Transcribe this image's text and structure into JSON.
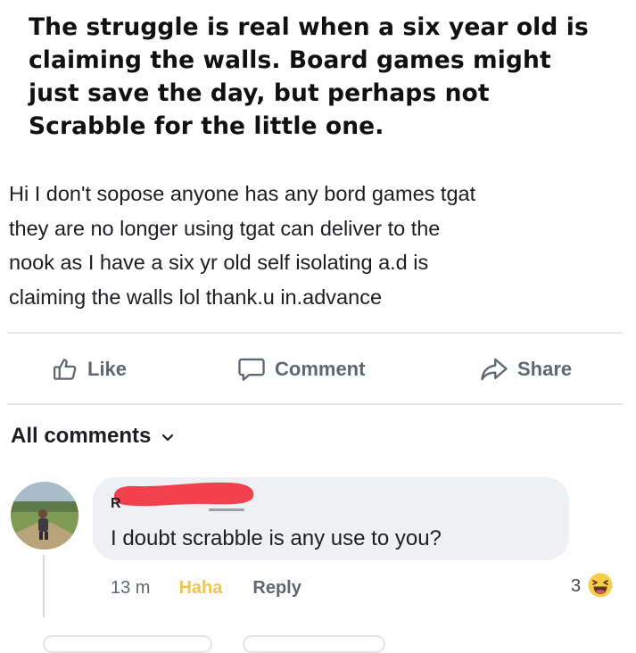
{
  "caption": {
    "line1": "The struggle is real when a six year old is",
    "line2": "claiming the walls. Board games might",
    "line3": "just save the day, but perhaps not",
    "line4": "Scrabble for the little one."
  },
  "post": {
    "line1": "Hi I don't sopose anyone has any bord games tgat",
    "line2": "they are no longer using tgat can deliver to the",
    "line3": "nook as I have a six yr old self isolating a.d is",
    "line4": "claiming the walls lol  thank.u in.advance"
  },
  "actions": {
    "like_label": "Like",
    "comment_label": "Comment",
    "share_label": "Share"
  },
  "comments_filter": {
    "label": "All comments"
  },
  "comment": {
    "author_initial": "R",
    "text": "I doubt scrabble is any use to you?",
    "time": "13 m",
    "haha_label": "Haha",
    "reply_label": "Reply",
    "reaction_count": "3",
    "reaction_icon": "haha-emoji"
  },
  "colors": {
    "redaction": "#f0414c",
    "haha": "#f3c44a",
    "bubble": "#eef0f4",
    "muted_text": "#606770"
  }
}
